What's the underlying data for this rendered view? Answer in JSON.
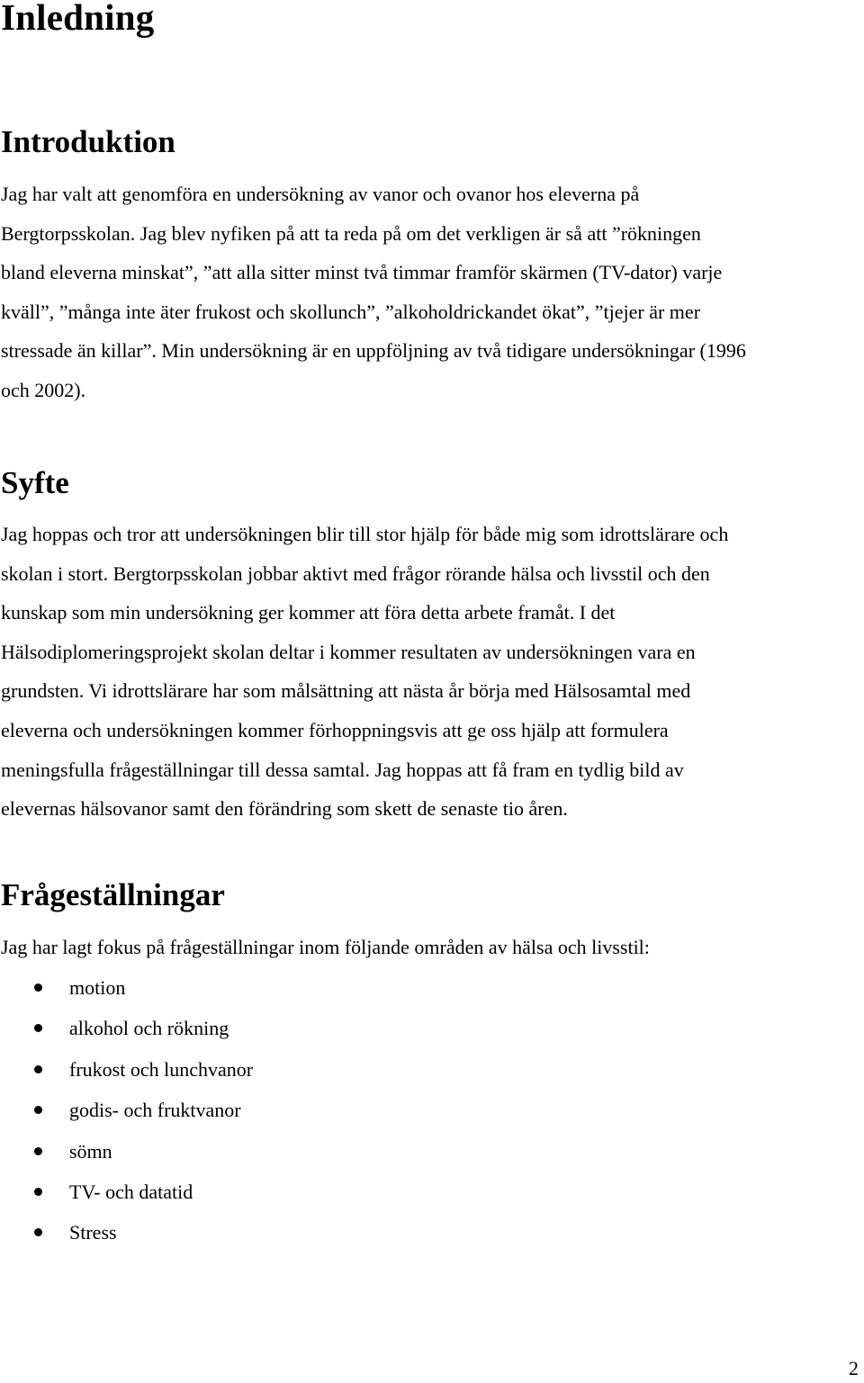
{
  "document": {
    "title": "Inledning",
    "sections": [
      {
        "heading": "Introduktion",
        "lines": [
          "Jag har valt att genomföra en undersökning av vanor och ovanor hos eleverna på",
          "Bergtorpsskolan. Jag blev nyfiken på att ta reda på om det verkligen är så att ”rökningen",
          "bland eleverna minskat”, ”att alla sitter minst två timmar framför skärmen (TV-dator) varje",
          "kväll”, ”många inte äter frukost och skollunch”, ”alkoholdrickandet ökat”, ”tjejer är mer",
          "stressade än killar”. Min undersökning är en uppföljning av två tidigare undersökningar (1996",
          "och 2002)."
        ]
      },
      {
        "heading": "Syfte",
        "lines": [
          "Jag hoppas och tror att undersökningen blir till stor hjälp för både mig som idrottslärare och",
          "skolan i stort. Bergtorpsskolan jobbar aktivt med frågor rörande hälsa och livsstil och den",
          "kunskap som min undersökning ger kommer att föra detta arbete framåt. I det",
          "Hälsodiplomeringsprojekt skolan deltar i kommer resultaten av undersökningen vara en",
          "grundsten. Vi idrottslärare har som målsättning att nästa år börja med Hälsosamtal med",
          "eleverna och undersökningen kommer förhoppningsvis att ge oss hjälp att formulera",
          "meningsfulla frågeställningar till dessa samtal. Jag hoppas att få fram en tydlig bild av",
          "elevernas hälsovanor samt den förändring som skett de senaste tio åren."
        ]
      },
      {
        "heading": "Frågeställningar",
        "lines": [
          "Jag har lagt fokus på frågeställningar inom följande områden av hälsa och livsstil:"
        ],
        "bullets": [
          "motion",
          "alkohol och rökning",
          "frukost och lunchvanor",
          "godis- och fruktvanor",
          "sömn",
          "TV- och datatid",
          "Stress"
        ]
      }
    ],
    "page_number": "2"
  }
}
